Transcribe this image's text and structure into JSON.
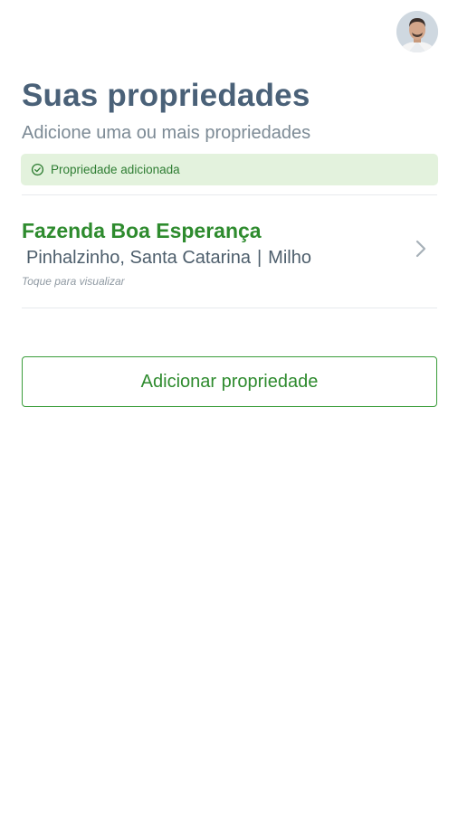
{
  "header": {
    "avatar_icon": "user-avatar"
  },
  "page": {
    "title": "Suas propriedades",
    "subtitle": "Adicione uma ou mais propriedades"
  },
  "status": {
    "icon": "check-circle-icon",
    "text": "Propriedade adicionada",
    "color": "#2e7d32",
    "background": "#e3f2dd"
  },
  "properties": [
    {
      "name": "Fazenda Boa Esperança",
      "location": "Pinhalzinho, Santa Catarina",
      "separator": "|",
      "crop": "Milho",
      "hint": "Toque para visualizar",
      "action_icon": "chevron-right-icon"
    }
  ],
  "actions": {
    "add_label": "Adicionar propriedade"
  },
  "colors": {
    "accent": "#2e8b2e",
    "title": "#4a6178"
  }
}
